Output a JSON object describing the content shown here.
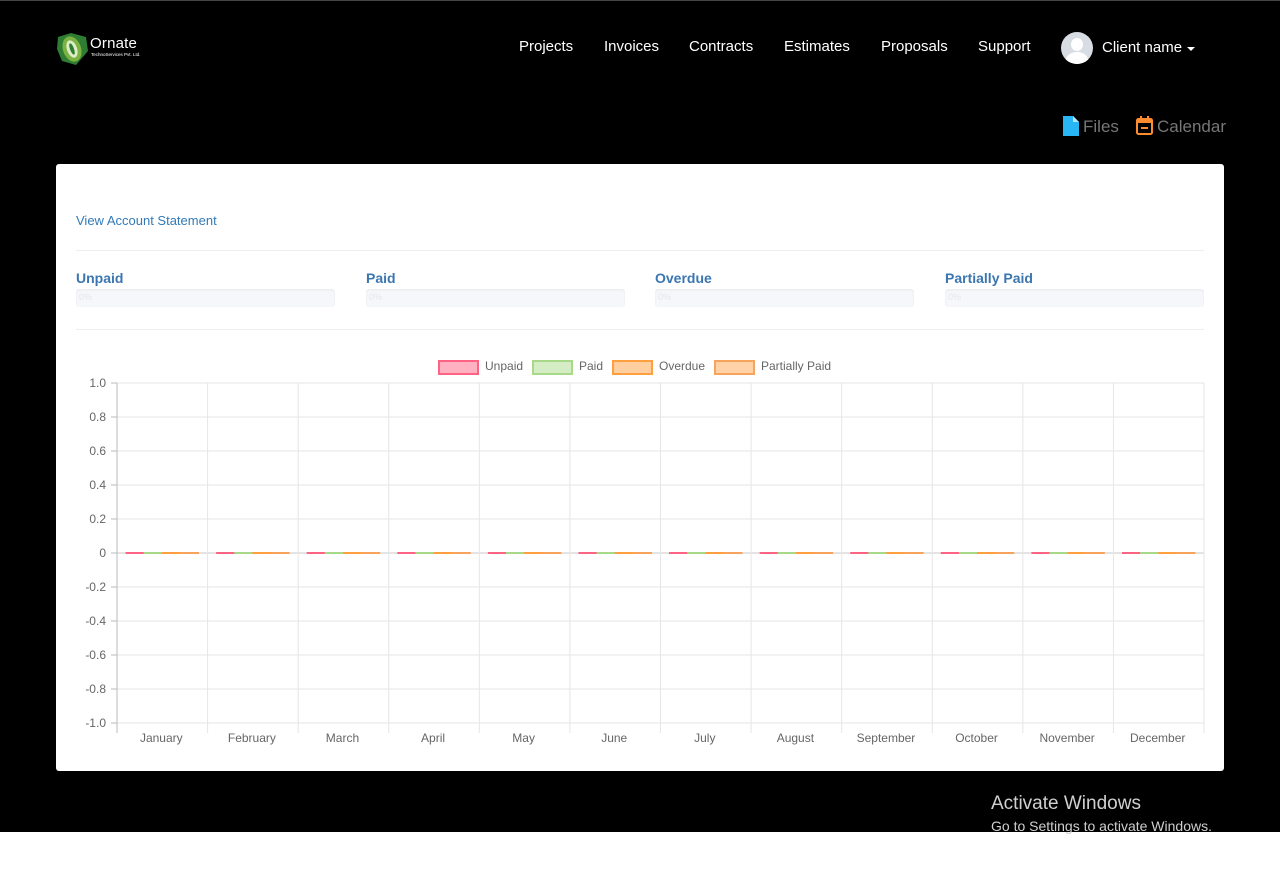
{
  "brand": {
    "name": "Ornate",
    "tagline": "TechnoServices Pvt. Ltd.",
    "colors": {
      "leaf_outer": "#2e7d32",
      "leaf_inner": "#7cb342"
    }
  },
  "nav": {
    "items": [
      {
        "label": "Projects"
      },
      {
        "label": "Invoices"
      },
      {
        "label": "Contracts"
      },
      {
        "label": "Estimates"
      },
      {
        "label": "Proposals"
      },
      {
        "label": "Support"
      }
    ],
    "user": {
      "name": "Client name",
      "avatar_icon": "user-avatar-icon",
      "caret_icon": "caret-down-icon"
    }
  },
  "quick_links": {
    "files": {
      "label": "Files",
      "icon": "file-icon",
      "color": "#29b6f6"
    },
    "calendar": {
      "label": "Calendar",
      "icon": "calendar-icon",
      "color": "#ff8c2e"
    }
  },
  "panel": {
    "statement_link": "View Account Statement",
    "stats": [
      {
        "title": "Unpaid",
        "percent": "0%"
      },
      {
        "title": "Paid",
        "percent": "0%"
      },
      {
        "title": "Overdue",
        "percent": "0%"
      },
      {
        "title": "Partially Paid",
        "percent": "0%"
      }
    ]
  },
  "chart_data": {
    "type": "bar",
    "title": "",
    "xlabel": "",
    "ylabel": "",
    "categories": [
      "January",
      "February",
      "March",
      "April",
      "May",
      "June",
      "July",
      "August",
      "September",
      "October",
      "November",
      "December"
    ],
    "ylim": [
      -1.0,
      1.0
    ],
    "yticks": [
      "1.0",
      "0.8",
      "0.6",
      "0.4",
      "0.2",
      "0",
      "-0.2",
      "-0.4",
      "-0.6",
      "-0.8",
      "-1.0"
    ],
    "grid": true,
    "legend_position": "top",
    "series": [
      {
        "name": "Unpaid",
        "color": "#ff6384",
        "fill": "#ffb1c1",
        "values": [
          0,
          0,
          0,
          0,
          0,
          0,
          0,
          0,
          0,
          0,
          0,
          0
        ]
      },
      {
        "name": "Paid",
        "color": "#a8d989",
        "fill": "#d4edc4",
        "values": [
          0,
          0,
          0,
          0,
          0,
          0,
          0,
          0,
          0,
          0,
          0,
          0
        ]
      },
      {
        "name": "Overdue",
        "color": "#ff9f40",
        "fill": "#ffcf9f",
        "values": [
          0,
          0,
          0,
          0,
          0,
          0,
          0,
          0,
          0,
          0,
          0,
          0
        ]
      },
      {
        "name": "Partially Paid",
        "color": "#f7a35c",
        "fill": "#ffd2a8",
        "values": [
          0,
          0,
          0,
          0,
          0,
          0,
          0,
          0,
          0,
          0,
          0,
          0
        ]
      }
    ]
  },
  "os_overlay": {
    "title": "Activate Windows",
    "subtitle": "Go to Settings to activate Windows."
  }
}
